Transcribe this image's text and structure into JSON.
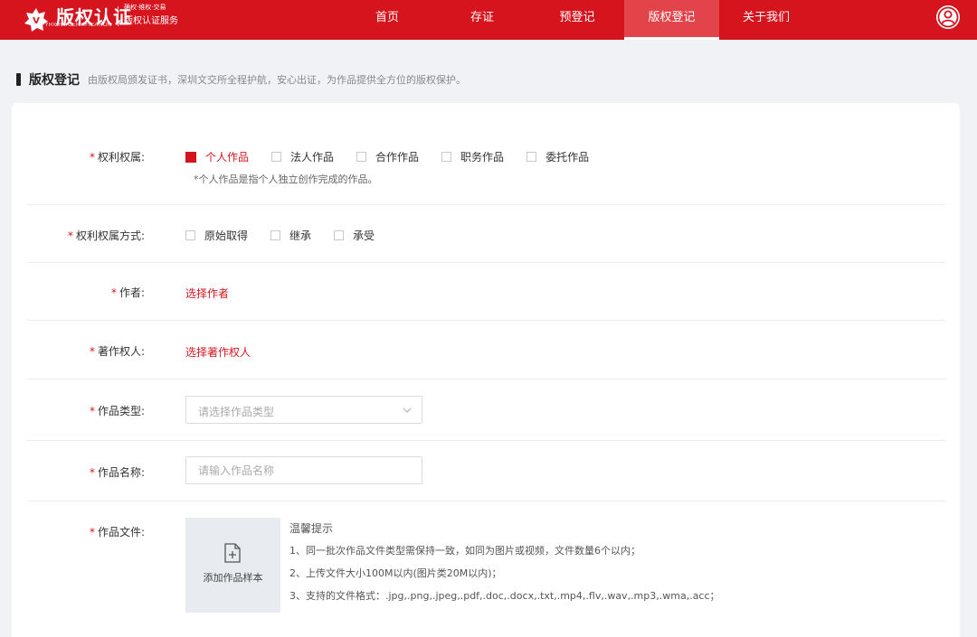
{
  "header": {
    "logo_title": "版权认证",
    "logo_en": "COPYRIGHT CERTIFICATION",
    "logo_tag": "确权·维权·交易",
    "logo_sub": "版权认证服务",
    "nav": [
      {
        "label": "首页",
        "active": false
      },
      {
        "label": "存证",
        "active": false
      },
      {
        "label": "预登记",
        "active": false
      },
      {
        "label": "版权登记",
        "active": true
      },
      {
        "label": "关于我们",
        "active": false
      }
    ],
    "user_icon": "user-avatar-icon",
    "colors": {
      "brand": "#d6141e",
      "active_tab": "#e3434a"
    }
  },
  "page": {
    "title": "版权登记",
    "description": "由版权局颁发证书，深圳文交所全程护航，安心出证，为作品提供全方位的版权保护。"
  },
  "form": {
    "required_mark": "*",
    "ownership": {
      "label": "权利权属:",
      "options": [
        {
          "label": "个人作品",
          "checked": true
        },
        {
          "label": "法人作品",
          "checked": false
        },
        {
          "label": "合作作品",
          "checked": false
        },
        {
          "label": "职务作品",
          "checked": false
        },
        {
          "label": "委托作品",
          "checked": false
        }
      ],
      "hint": "*个人作品是指个人独立创作完成的作品。"
    },
    "acquisition": {
      "label": "权利权属方式:",
      "options": [
        {
          "label": "原始取得",
          "checked": false
        },
        {
          "label": "继承",
          "checked": false
        },
        {
          "label": "承受",
          "checked": false
        }
      ]
    },
    "author": {
      "label": "作者:",
      "link": "选择作者"
    },
    "copyright_holder": {
      "label": "著作权人:",
      "link": "选择著作权人"
    },
    "work_type": {
      "label": "作品类型:",
      "placeholder": "请选择作品类型"
    },
    "work_name": {
      "label": "作品名称:",
      "placeholder": "请输入作品名称"
    },
    "work_file": {
      "label": "作品文件:",
      "upload_label": "添加作品样本",
      "tips_title": "温馨提示",
      "tips": [
        "1、同一批次作品文件类型需保持一致，如同为图片或视频，文件数量6个以内；",
        "2、上传文件大小100M以内(图片类20M以内)；",
        "3、支持的文件格式：.jpg,.png,.jpeg,.pdf,.doc,.docx,.txt,.mp4,.flv,.wav,.mp3,.wma,.acc；"
      ]
    }
  }
}
